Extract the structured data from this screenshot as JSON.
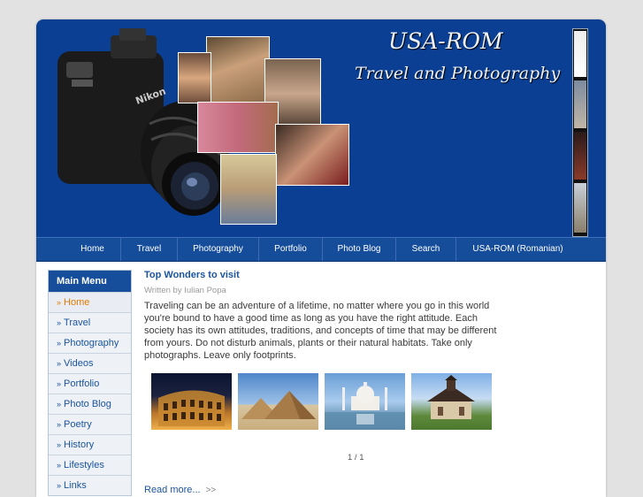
{
  "site": {
    "title": "USA-ROM",
    "subtitle": "Travel and Photography"
  },
  "nav": {
    "items": [
      "Home",
      "Travel",
      "Photography",
      "Portfolio",
      "Photo Blog",
      "Search",
      "USA-ROM (Romanian)"
    ]
  },
  "sidebar": {
    "title": "Main Menu",
    "items": [
      "Home",
      "Travel",
      "Photography",
      "Videos",
      "Portfolio",
      "Photo Blog",
      "Poetry",
      "History",
      "Lifestyles",
      "Links"
    ],
    "active_item": "Home"
  },
  "article": {
    "title": "Top Wonders to visit",
    "byline": "Written by Iulian Popa",
    "body": "Traveling can be an adventure of a lifetime, no matter where you go in this world you're bound to have a good time as long as you have the right attitude. Each society has its own attitudes, traditions, and concepts of time that may be different from yours. Do not disturb animals, plants or their natural habitats. Take only photographs. Leave only footprints.",
    "pager": "1 / 1",
    "read_more": "Read more...",
    "read_more_arrows": ">>"
  },
  "colors": {
    "header_bg": "#0a3f94",
    "nav_bg": "#154d9a",
    "link": "#1b55a0",
    "active": "#e07b00"
  }
}
